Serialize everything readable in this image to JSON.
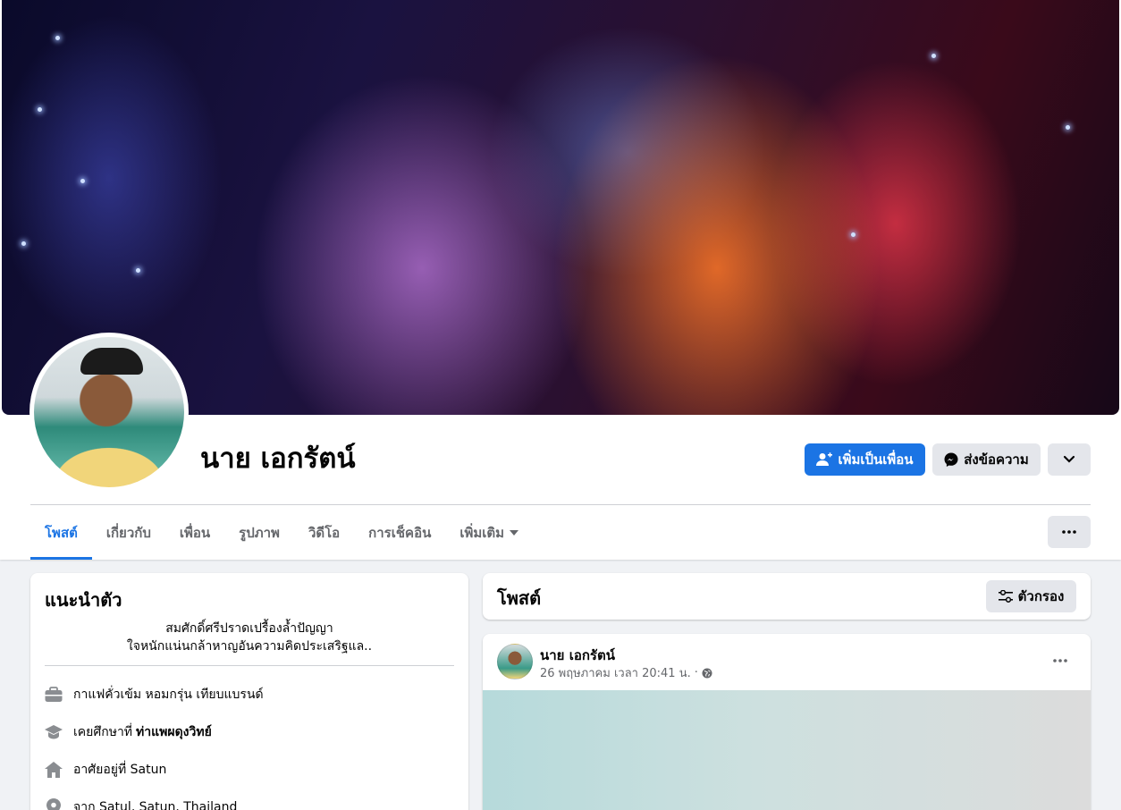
{
  "profile": {
    "name": "นาย เอกรัตน์"
  },
  "actions": {
    "add_friend": "เพิ่มเป็นเพื่อน",
    "message": "ส่งข้อความ"
  },
  "tabs": [
    {
      "label": "โพสต์",
      "active": true
    },
    {
      "label": "เกี่ยวกับ",
      "active": false
    },
    {
      "label": "เพื่อน",
      "active": false
    },
    {
      "label": "รูปภาพ",
      "active": false
    },
    {
      "label": "วิดีโอ",
      "active": false
    },
    {
      "label": "การเช็คอิน",
      "active": false
    },
    {
      "label": "เพิ่มเติม",
      "active": false
    }
  ],
  "intro": {
    "title": "แนะนำตัว",
    "bio_line1": "สมศักดิ์ศรีปราดเปรื้องล้ำปัญญา",
    "bio_line2": "ใจหนักแน่นกล้าหาญอันความคิดประเสริฐแล..",
    "work": "กาแฟคั่วเข้ม หอมกรุ่น เทียบแบรนด์",
    "education_prefix": "เคยศึกษาที่",
    "education_school": "ท่าแพผดุงวิทย์",
    "lives_in": "อาศัยอยู่ที่ Satun",
    "from": "จาก Satul, Satun, Thailand"
  },
  "posts": {
    "title": "โพสต์",
    "filter_label": "ตัวกรอง",
    "items": [
      {
        "author": "นาย เอกรัตน์",
        "time": "26 พฤษภาคม เวลา 20:41 น."
      }
    ]
  },
  "colors": {
    "accent": "#1b74e4",
    "secondary_button": "#e4e6eb",
    "background": "#f0f2f5",
    "muted_text": "#65676b"
  },
  "icons": [
    "add-friend-icon",
    "messenger-icon",
    "chevron-down-icon",
    "more-dots-icon",
    "filter-icon",
    "briefcase-icon",
    "graduation-cap-icon",
    "home-icon",
    "location-pin-icon",
    "globe-icon",
    "dropdown-triangle-icon"
  ]
}
